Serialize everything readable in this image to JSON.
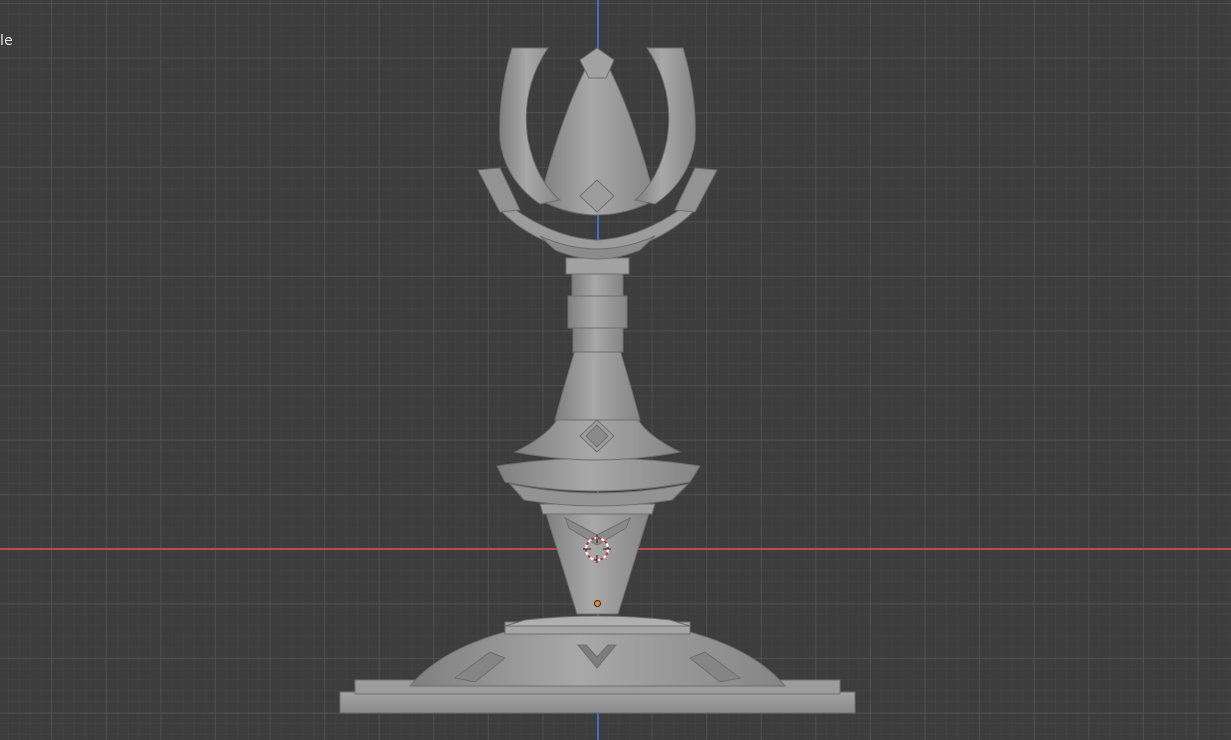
{
  "viewport": {
    "view_label": "le",
    "background_color": "#3d3d3d",
    "x_axis_color": "#c0484f",
    "z_axis_color": "#3d6fc2",
    "model_color": "#9a9a9a",
    "origin_color": "#f08a1a"
  },
  "icons": {
    "cursor": "3d-cursor-icon",
    "origin": "object-origin-icon"
  }
}
